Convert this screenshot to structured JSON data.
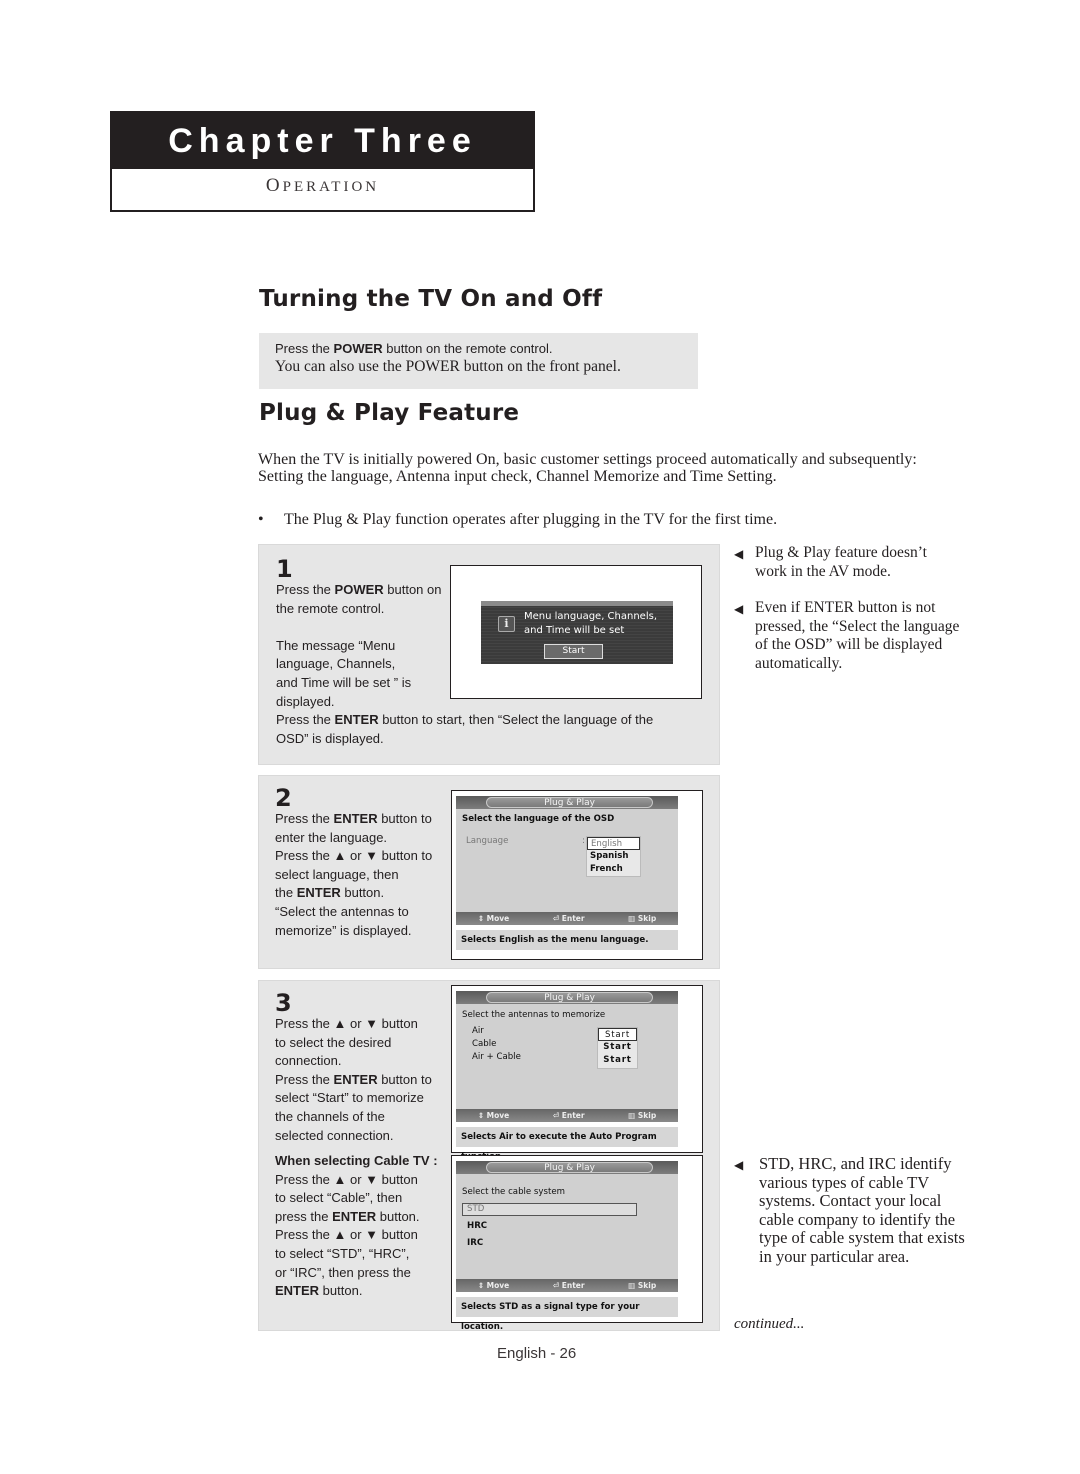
{
  "chapter": {
    "title": "Chapter Three",
    "subtitle_first": "O",
    "subtitle_rest": "PERATION"
  },
  "section_power": {
    "title": "Turning the TV On and Off",
    "line1_pre": "Press the ",
    "line1_bold": "POWER",
    "line1_post": " button on the remote control.",
    "line2": "You can also use the POWER button on the front panel."
  },
  "section_plug": {
    "title": "Plug & Play Feature",
    "intro": "When the TV is initially powered On, basic customer settings proceed automatically and subsequently: Setting the language, Antenna input check, Channel Memorize and Time Setting.",
    "bullet_symbol": "•",
    "bullet": "The Plug & Play function operates after plugging in the TV for the first time."
  },
  "steps": [
    {
      "number": "1",
      "t1_pre": "Press the ",
      "t1_bold": "POWER",
      "t1_post": " button on",
      "t2": "the remote control.",
      "t3": "The message “Menu",
      "t4": "language, Channels,",
      "t5": "and Time will be set ” is",
      "t6": "displayed.",
      "t7_pre": "Press the ",
      "t7_bold": "ENTER",
      "t7_post": " button to start, then “Select the language of the",
      "t8": "OSD” is displayed.",
      "osd": {
        "info_icon": "i",
        "message_line1": "Menu language, Channels,",
        "message_line2": "and Time will be set",
        "button": "Start"
      }
    },
    {
      "number": "2",
      "t1_pre": "Press the ",
      "t1_bold": "ENTER",
      "t1_post": " button to",
      "t2": "enter the language.",
      "t3": "Press the ▲ or ▼ button to",
      "t4": "select language, then",
      "t5_pre": "the ",
      "t5_bold": "ENTER",
      "t5_post": " button.",
      "t6": "“Select the antennas to",
      "t7": "memorize” is displayed.",
      "osd": {
        "title": "Plug & Play",
        "heading": "Select the language of the OSD",
        "field_label": "Language",
        "field_sep": ":",
        "options": [
          "English",
          "Spanish",
          "French"
        ],
        "selected": "English",
        "nav": [
          "⇕ Move",
          "⏎ Enter",
          "▥ Skip"
        ],
        "hint": "Selects English as the menu language."
      }
    },
    {
      "number": "3",
      "t1": "Press the ▲ or ▼ button",
      "t2": "to select the desired",
      "t3": "connection.",
      "t4_pre": "Press the ",
      "t4_bold": "ENTER",
      "t4_post": " button to",
      "t5": "select “Start” to memorize",
      "t6": "the channels of the",
      "t7": "selected connection.",
      "osd": {
        "title": "Plug & Play",
        "heading": "Select the antennas to memorize",
        "rows": [
          {
            "label": "Air",
            "action": "Start"
          },
          {
            "label": "Cable",
            "action": "Start"
          },
          {
            "label": "Air + Cable",
            "action": "Start"
          }
        ],
        "nav": [
          "⇕ Move",
          "⏎ Enter",
          "▥ Skip"
        ],
        "hint": "Selects Air to execute the Auto Program function."
      },
      "cable": {
        "heading": "When selecting Cable TV :",
        "c1": "Press the ▲ or ▼ button",
        "c2": "to select “Cable”, then",
        "c3_pre": "press the ",
        "c3_bold": "ENTER",
        "c3_post": " button.",
        "c4": "Press the ▲ or ▼ button",
        "c5": "to select “STD”, “HRC”,",
        "c6": "or “IRC”, then press the",
        "c7_bold": "ENTER",
        "c7_post": " button.",
        "osd": {
          "title": "Plug & Play",
          "heading": "Select the cable system",
          "options": [
            "STD",
            "HRC",
            "IRC"
          ],
          "selected": "STD",
          "nav": [
            "⇕ Move",
            "⏎ Enter",
            "▥ Skip"
          ],
          "hint": "Selects STD as a signal type for your location."
        }
      }
    }
  ],
  "notes": [
    {
      "icon": "◀",
      "text": "Plug & Play feature doesn’t work in the AV mode."
    },
    {
      "icon": "◀",
      "text_pre": "Even if ",
      "text_bold": "ENTER",
      "text_post": " button is not pressed, the “Select the language of the OSD” will be displayed automatically."
    },
    {
      "icon": "◀",
      "text": "STD, HRC, and IRC identify various types of cable TV systems. Contact your local cable company to identify the type of cable system that exists in your particular area."
    }
  ],
  "continued": "continued...",
  "page_number": "English - 26"
}
